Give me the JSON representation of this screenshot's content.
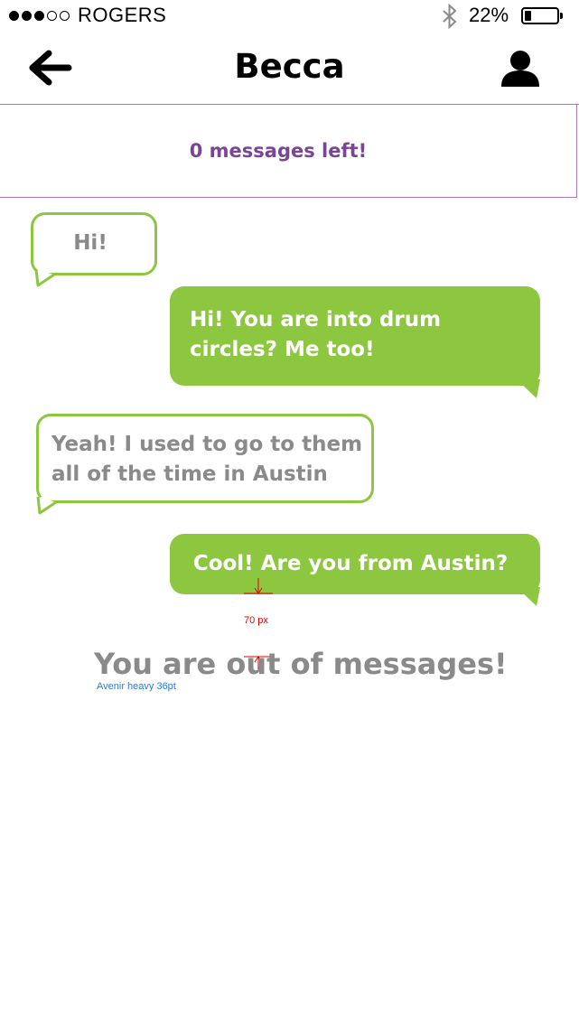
{
  "status_bar": {
    "signal_filled": 3,
    "signal_total": 5,
    "carrier": "ROGERS",
    "battery_percent": "22%",
    "battery_level": 0.22
  },
  "nav": {
    "title": "Becca",
    "back_icon": "arrow-left-icon",
    "profile_icon": "person-icon"
  },
  "banner": {
    "text": "0 messages left!"
  },
  "messages": [
    {
      "direction": "incoming",
      "text": "Hi!"
    },
    {
      "direction": "outgoing",
      "text": "Hi! You are into drum circles? Me too!"
    },
    {
      "direction": "incoming",
      "text": "Yeah! I used to go to them all of the time in Austin"
    },
    {
      "direction": "outgoing",
      "text": "Cool! Are you from Austin?"
    }
  ],
  "notice": {
    "text": "You are out of messages!"
  },
  "annotations": {
    "spacing_label": "70 px",
    "font_label": "Avenir heavy 36pt"
  },
  "colors": {
    "accent_green": "#8dc63f",
    "banner_purple": "#7a4594",
    "divider_purple": "#a47ab3",
    "muted_text": "#8a8a8a"
  }
}
